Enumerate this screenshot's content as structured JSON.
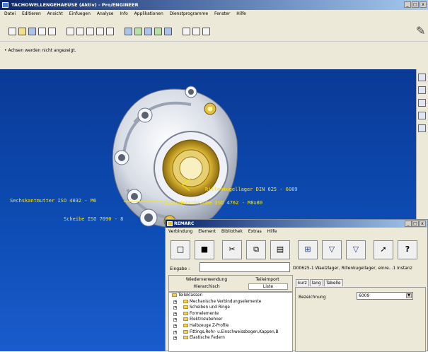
{
  "main_window": {
    "title": "TACHOWELLENGEHAEUSE (Aktiv) - Pro/ENGINEER",
    "controls": [
      "_",
      "□",
      "x"
    ]
  },
  "menu": [
    "Datei",
    "Editieren",
    "Ansicht",
    "Einfuegen",
    "Analyse",
    "Info",
    "Applikationen",
    "Dienstprogramme",
    "Fenster",
    "Hilfe"
  ],
  "toolbar_icons": [
    "new-file-icon",
    "open-file-icon",
    "save-icon",
    "print-icon",
    "print-preview-icon",
    "view-icon",
    "view-icon",
    "view-icon",
    "view-icon",
    "view-icon",
    "sketch-icon",
    "sketch-icon",
    "sketch-icon",
    "sketch-icon",
    "sketch-icon",
    "window-icon",
    "window-icon",
    "window-icon"
  ],
  "message": "• Achsen werden nicht angezeigt.",
  "annotations": {
    "bearing": "Rillenkugellager DIN 625 - 6009",
    "nut": "Sechskantmutter ISO 4032 - M6",
    "screw": "Zylinderschraube ISO 4762 - M8x80",
    "washer": "Scheibe ISO 7090 - 8"
  },
  "remarc": {
    "title": "REMARC",
    "controls": [
      "_",
      "□",
      "x"
    ],
    "menu": [
      "Verbindung",
      "Element",
      "Bibliothek",
      "Extras",
      "Hilfe"
    ],
    "toolbar": [
      "new-file-icon",
      "save-icon",
      "cut-icon",
      "copy-icon",
      "paste-icon",
      "part-icon",
      "part-icon",
      "part-icon",
      "arrow-icon",
      "help-icon"
    ],
    "help_label": "?",
    "input_label": "Eingabe :",
    "input_value": "",
    "tabs_top": [
      "Wiederverwendung",
      "Teileimport"
    ],
    "tabs_bottom": [
      "Hierarchisch",
      "Liste"
    ],
    "tree": [
      "Teileklassen",
      "Mechanische Verbindungselemente",
      "Scheiben und Ringe",
      "Formelemente",
      "Elektrozubehoer",
      "Halbzeuge Z-Profile",
      "Fittings,Rohr- u.Einschweissbogen,Kappen,B",
      "Elastische Federn"
    ],
    "part_info": "D00625-1 Waelzlager, Rillenkugellager, einre...1 Instanz",
    "detail_tabs": [
      "kurz",
      "lang",
      "Tabelle"
    ],
    "field_label": "Bezeichnung",
    "field_value": "6009"
  }
}
